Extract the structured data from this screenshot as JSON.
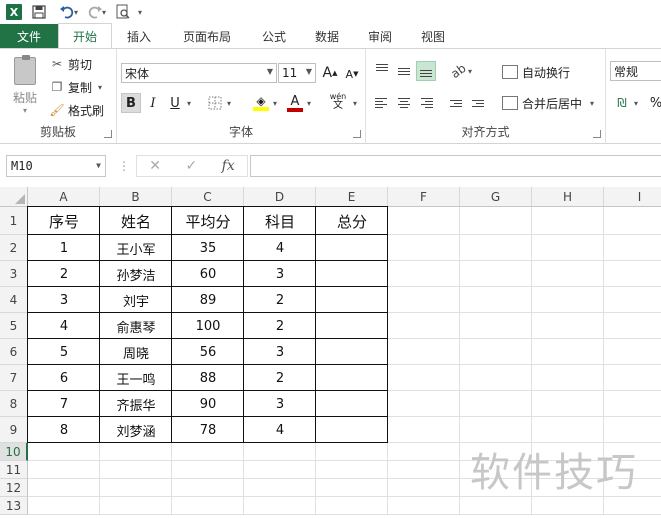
{
  "qat": {
    "app_icon_letter": "X",
    "save_icon": "floppy-disk-icon",
    "undo_icon": "undo-icon",
    "redo_icon": "redo-icon",
    "preview_icon": "print-preview-icon"
  },
  "tabs": [
    {
      "label": "文件"
    },
    {
      "label": "开始"
    },
    {
      "label": "插入"
    },
    {
      "label": "页面布局"
    },
    {
      "label": "公式"
    },
    {
      "label": "数据"
    },
    {
      "label": "审阅"
    },
    {
      "label": "视图"
    }
  ],
  "ribbon": {
    "clipboard": {
      "paste_label": "粘贴",
      "cut_label": "剪切",
      "copy_label": "复制",
      "format_painter_label": "格式刷",
      "group_label": "剪贴板"
    },
    "font": {
      "font_name": "宋体",
      "font_size": "11",
      "grow_label": "A",
      "shrink_label": "A",
      "bold_label": "B",
      "italic_label": "I",
      "underline_label": "U",
      "phonetic_label": "wén",
      "font_color_label": "A",
      "group_label": "字体",
      "font_color": "#c00000",
      "fill_color": "#ffff00"
    },
    "alignment": {
      "wrap_label": "自动换行",
      "merge_label": "合并后居中",
      "group_label": "对齐方式"
    },
    "number": {
      "format_label": "常规",
      "percent_label": "%"
    }
  },
  "formula_bar": {
    "name_box": "M10",
    "cancel_icon": "✕",
    "enter_icon": "✓",
    "fx_label": "fx",
    "formula": ""
  },
  "sheet": {
    "columns": [
      "A",
      "B",
      "C",
      "D",
      "E",
      "F",
      "G",
      "H",
      "I"
    ],
    "rows": [
      "1",
      "2",
      "3",
      "4",
      "5",
      "6",
      "7",
      "8",
      "9",
      "10",
      "11",
      "12",
      "13"
    ],
    "active_row": "10",
    "table_header": [
      "序号",
      "姓名",
      "平均分",
      "科目",
      "总分"
    ],
    "table_rows": [
      [
        "1",
        "王小军",
        "35",
        "4",
        ""
      ],
      [
        "2",
        "孙梦洁",
        "60",
        "3",
        ""
      ],
      [
        "3",
        "刘宇",
        "89",
        "2",
        ""
      ],
      [
        "4",
        "俞惠琴",
        "100",
        "2",
        ""
      ],
      [
        "5",
        "周晓",
        "56",
        "3",
        ""
      ],
      [
        "6",
        "王一鸣",
        "88",
        "2",
        ""
      ],
      [
        "7",
        "齐振华",
        "90",
        "3",
        ""
      ],
      [
        "8",
        "刘梦涵",
        "78",
        "4",
        ""
      ]
    ]
  },
  "watermark": "软件技巧"
}
